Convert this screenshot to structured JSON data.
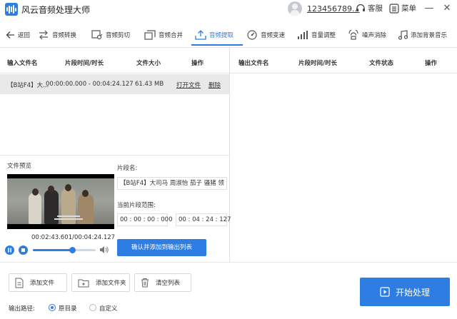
{
  "app": {
    "title": "风云音频处理大师",
    "accent": "#2d7de2"
  },
  "header": {
    "username": "123456789...",
    "support_label": "客服",
    "menu_label": "菜单"
  },
  "toolbar": {
    "back": "返回",
    "items": [
      "音频转换",
      "音频剪切",
      "音频合并",
      "音频提取",
      "音频变速",
      "音量调整",
      "噪声消除",
      "添加背景音乐"
    ],
    "active": "音频提取"
  },
  "input_table": {
    "headers": [
      "输入文件名",
      "片段时间/时长",
      "文件大小",
      "操作"
    ],
    "rows": [
      {
        "name": "【B站F4】大...",
        "duration": "00:00:00.000 - 00:04:24.127",
        "size": "61.43 MB",
        "open": "打开文件",
        "delete": "删除"
      }
    ]
  },
  "output_table": {
    "headers": [
      "输出文件名",
      "片段时间/时长",
      "文件状态",
      "操作"
    ]
  },
  "preview": {
    "label": "文件预览",
    "time": "00:02:43.601/00:04:24.127",
    "progress": 0.62
  },
  "segment": {
    "name_label": "片段名:",
    "name_value": "【B站F4】大司马 周淑怡 茄子 骚猪 领",
    "range_label": "当前片段范围:",
    "start": "00 : 00 : 00 : 000",
    "end": "00 : 04 : 24 : 127",
    "confirm": "确认并添加到输出列表"
  },
  "bottom": {
    "add_file": "添加文件",
    "add_folder": "添加文件夹",
    "clear": "清空列表",
    "start": "开始处理",
    "output_path_label": "输出路径:",
    "option_original": "原目录",
    "option_custom": "自定义",
    "selected": "原目录"
  }
}
